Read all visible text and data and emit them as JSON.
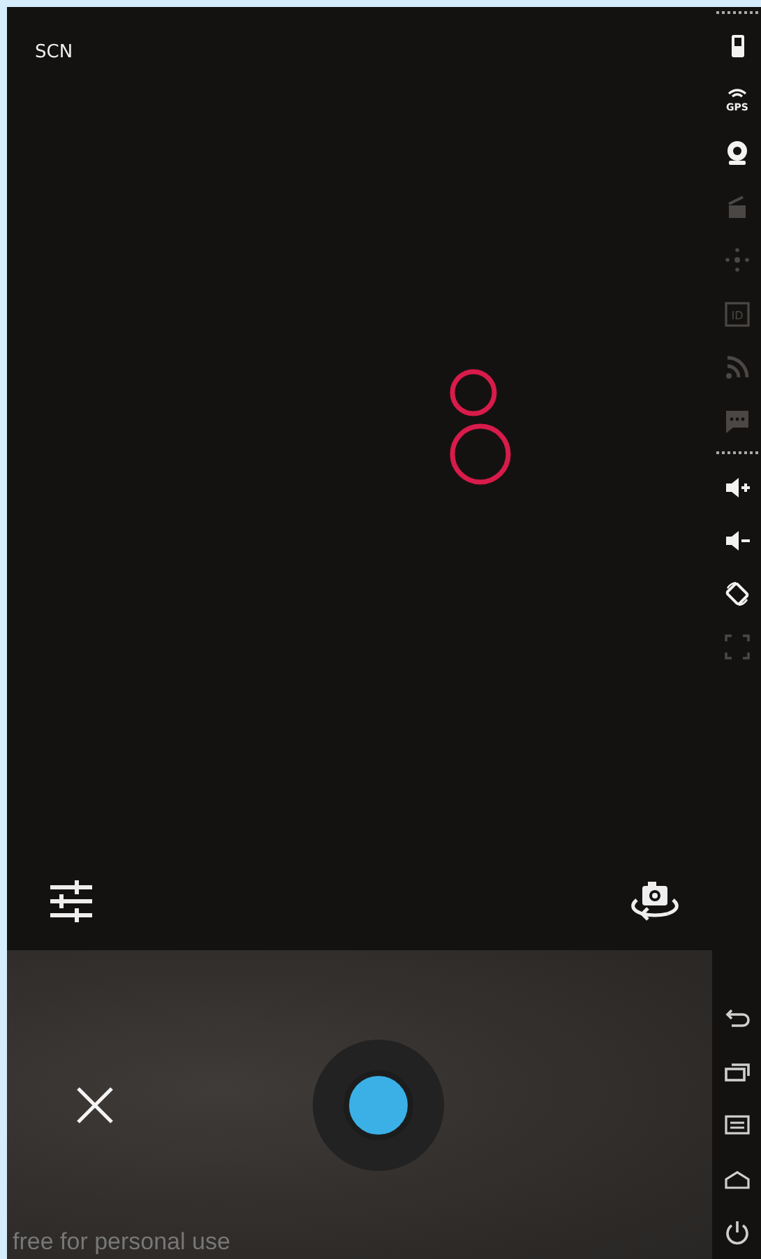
{
  "scene_label": "SCN",
  "toolbar_top": [
    {
      "kind": "battery",
      "disabled": false
    },
    {
      "kind": "gps",
      "label": "GPS",
      "disabled": false
    },
    {
      "kind": "webcam",
      "disabled": false
    },
    {
      "kind": "clapper",
      "disabled": true
    },
    {
      "kind": "dpad",
      "disabled": true
    },
    {
      "kind": "id",
      "label": "ID",
      "disabled": true
    },
    {
      "kind": "rss",
      "disabled": true
    },
    {
      "kind": "chat",
      "disabled": true
    }
  ],
  "toolbar_middle": [
    {
      "kind": "volume_up",
      "disabled": false
    },
    {
      "kind": "volume_down",
      "disabled": false
    },
    {
      "kind": "rotate",
      "disabled": false
    },
    {
      "kind": "fullscreen",
      "disabled": true
    }
  ],
  "nav_buttons": [
    {
      "kind": "back"
    },
    {
      "kind": "recent"
    },
    {
      "kind": "menu"
    },
    {
      "kind": "home"
    },
    {
      "kind": "power"
    }
  ],
  "camera_controls": {
    "settings": {
      "kind": "sliders"
    },
    "switch_camera": {
      "kind": "switch"
    },
    "cancel": {
      "kind": "close"
    },
    "shutter": {
      "kind": "record"
    }
  },
  "footer_text": "free for personal use"
}
